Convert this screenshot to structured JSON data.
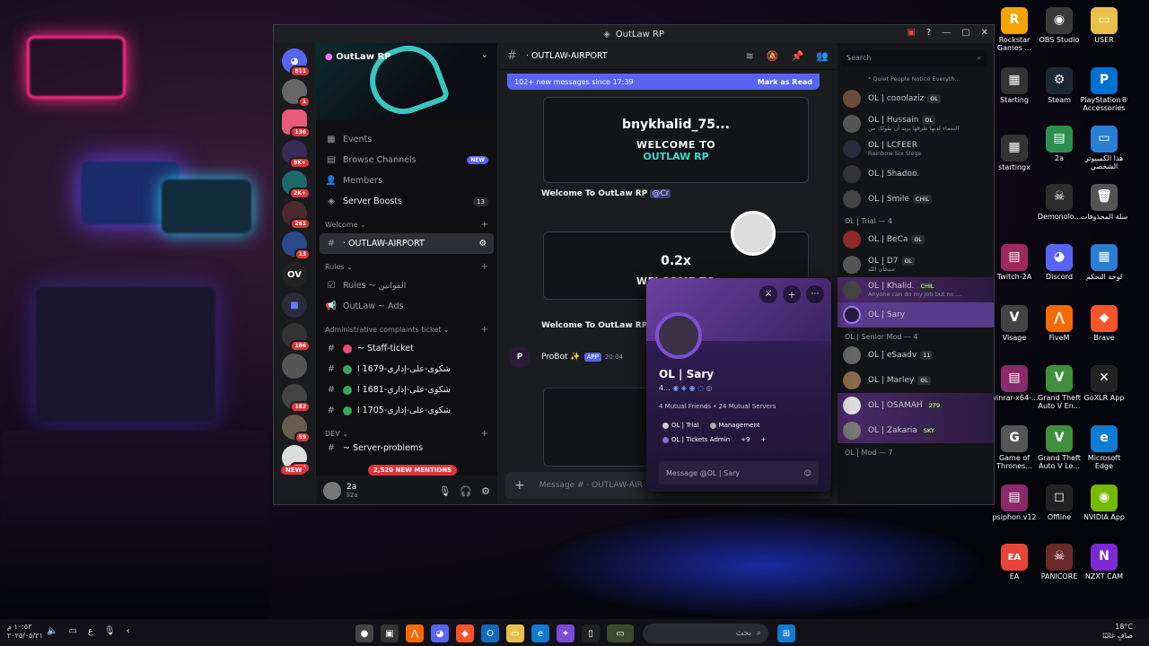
{
  "window": {
    "title": "OutLaw RP"
  },
  "server": {
    "name": "OutLaw RP",
    "rail": [
      {
        "badge": "811"
      },
      {
        "badge": "1"
      },
      {
        "badge": "136"
      },
      {
        "badge": "9K+"
      },
      {
        "badge": "2K+"
      },
      {
        "badge": "261"
      },
      {
        "badge": "13"
      },
      {
        "label": "OV"
      },
      {
        "badge": ""
      },
      {
        "badge": "186"
      },
      {
        "badge": ""
      },
      {
        "badge": "182"
      },
      {
        "badge": "59"
      },
      {
        "badge": "336"
      }
    ],
    "rail_new": "NEW"
  },
  "channels": {
    "top": [
      {
        "label": "Events",
        "icon": "calendar-icon"
      },
      {
        "label": "Browse Channels",
        "icon": "browse-icon",
        "new": "NEW"
      },
      {
        "label": "Members",
        "icon": "members-icon"
      },
      {
        "label": "Server Boosts",
        "icon": "boost-icon",
        "count": "13"
      }
    ],
    "cat_welcome": "Welcome",
    "active_channel": "· OUTLAW-AIRPORT",
    "cat_rules": "Rules",
    "rules_channel": "Rules ~ القوانين",
    "ads_channel": "OutLaw ~ Ads",
    "cat_admin": "Administrative complaints ticket",
    "staff_ticket": "~ Staff-ticket",
    "tickets": [
      "شكوى-على-إداري-1679 ا",
      "شكوى-على-إداري-1681 ا",
      "شكوى-على-إداري-1705 ا"
    ],
    "cat_dev": "DEV",
    "dev_channel": "~ Server-problems",
    "mentions": "2,520 NEW MENTIONS"
  },
  "user": {
    "name": "2a",
    "status": "li2a"
  },
  "chat": {
    "channel": "· OUTLAW-AIRPORT",
    "new_banner": "102+ new messages since 17:39",
    "mark_read": "Mark as Read",
    "card1_name": "bnykhalid_75...",
    "card2_name": "0.2x",
    "welcome_title": "WELCOME TO",
    "welcome_brand": "OUTLAW RP",
    "welcome_msg": "Welcome To OutLaw RP",
    "mention": "@Cr",
    "bot_name": "ProBot ✨",
    "bot_tag": "APP",
    "bot_time": "20:04",
    "input_placeholder": "Message # · OUTLAW-AIR"
  },
  "members": {
    "search": "Search",
    "top_status": "* Quiet People Notice Everyth...",
    "online": [
      {
        "name": "OL | cooolaziz",
        "tag": "OL"
      },
      {
        "name": "OL | Hussain",
        "tag": "OL",
        "status": "السماء لديها طرقها يريد أن يقولك من"
      },
      {
        "name": "OL | LCFEER",
        "status": "Rainbow Six Siege"
      },
      {
        "name": "OL | Shadoo."
      },
      {
        "name": "OL | Smile",
        "tag": "CHIL"
      }
    ],
    "trial_header": "OL | Trial — 4",
    "trial": [
      {
        "name": "OL | BeCa",
        "tag": "OL"
      },
      {
        "name": "OL | D7",
        "tag": "OL",
        "status": "سبحان الله"
      },
      {
        "name": "OL | Khalid.",
        "tag": "CHIL",
        "status": "Anyone can do my job but no ..."
      },
      {
        "name": "OL | Sary"
      }
    ],
    "senior_header": "OL | Senior Mod — 4",
    "senior": [
      {
        "name": "OL | eSaadv",
        "tag": "11"
      },
      {
        "name": "OL | Marley",
        "tag": "OL"
      },
      {
        "name": "OL | OSAMAH",
        "tag": "279"
      },
      {
        "name": "OL | Zakaria",
        "tag": "SKY"
      }
    ],
    "mod_header": "OL | Mod — 7"
  },
  "popout": {
    "name": "OL | Sary",
    "sub": "4...",
    "mutual": "4 Mutual Friends • 24 Mutual Servers",
    "roles": [
      "OL | Trial",
      "Management",
      "OL | Tickets Admin",
      "+9"
    ],
    "message": "Message @OL | Sary"
  },
  "desktop": {
    "icons": [
      {
        "label": "Rockstar Games ...",
        "color": "#f4a300",
        "glyph": "R"
      },
      {
        "label": "OBS Studio",
        "color": "#3a3a3a",
        "glyph": "◉"
      },
      {
        "label": "USER",
        "color": "#e8c04a",
        "glyph": "▭"
      },
      {
        "label": "Starting",
        "color": "#333",
        "glyph": "▦"
      },
      {
        "label": "Steam",
        "color": "#1b2838",
        "glyph": "⚙"
      },
      {
        "label": "PlayStation® Accessories",
        "color": "#0070d1",
        "glyph": "P"
      },
      {
        "label": "2a",
        "color": "#2d8f4e",
        "glyph": "▤"
      },
      {
        "label": "هذا الكمبيوتر الشخصي",
        "color": "#2a7fd4",
        "glyph": "▭"
      },
      {
        "label": "startingx",
        "color": "#333",
        "glyph": "▦"
      },
      {
        "label": "Demonolo...",
        "color": "#2d2d2d",
        "glyph": "☠"
      },
      {
        "label": "سلة المحذوفات",
        "color": "#555",
        "glyph": "🗑"
      },
      {
        "label": "Twitch-2A",
        "color": "#a02860",
        "glyph": "▤"
      },
      {
        "label": "Discord",
        "color": "#5865f2",
        "glyph": "◕"
      },
      {
        "label": "لوحة التحكم",
        "color": "#2a7fd4",
        "glyph": "▦"
      },
      {
        "label": "Visage",
        "color": "#444",
        "glyph": "V"
      },
      {
        "label": "FiveM",
        "color": "#f56a00",
        "glyph": "⋀"
      },
      {
        "label": "Brave",
        "color": "#fb542b",
        "glyph": "◆"
      },
      {
        "label": "winrar-x64-...",
        "color": "#8a2a6a",
        "glyph": "▤"
      },
      {
        "label": "Grand Theft Auto V En...",
        "color": "#3f8f3f",
        "glyph": "V"
      },
      {
        "label": "GoXLR App",
        "color": "#222",
        "glyph": "✕"
      },
      {
        "label": "Game of Thrones...",
        "color": "#555",
        "glyph": "G"
      },
      {
        "label": "Grand Theft Auto V Le...",
        "color": "#3f8f3f",
        "glyph": "V"
      },
      {
        "label": "Microsoft Edge",
        "color": "#0f7bd4",
        "glyph": "e"
      },
      {
        "label": "psiphon.v12",
        "color": "#8a2a6a",
        "glyph": "▤"
      },
      {
        "label": "Offline",
        "color": "#222",
        "glyph": "◻"
      },
      {
        "label": "NVIDIA App",
        "color": "#76b900",
        "glyph": "◉"
      },
      {
        "label": "EA",
        "color": "#e8443a",
        "glyph": "EA"
      },
      {
        "label": "PANICORE",
        "color": "#6a2a2a",
        "glyph": "☠"
      },
      {
        "label": "NZXT CAM",
        "color": "#7d2ad4",
        "glyph": "N"
      }
    ]
  },
  "taskbar": {
    "time": "١٠:٥٣ م",
    "date": "٢٠٢٥/٠٥/٢١",
    "search": "بحث",
    "weather_temp": "18°C",
    "weather_text": "صافٍ غالبًا"
  }
}
